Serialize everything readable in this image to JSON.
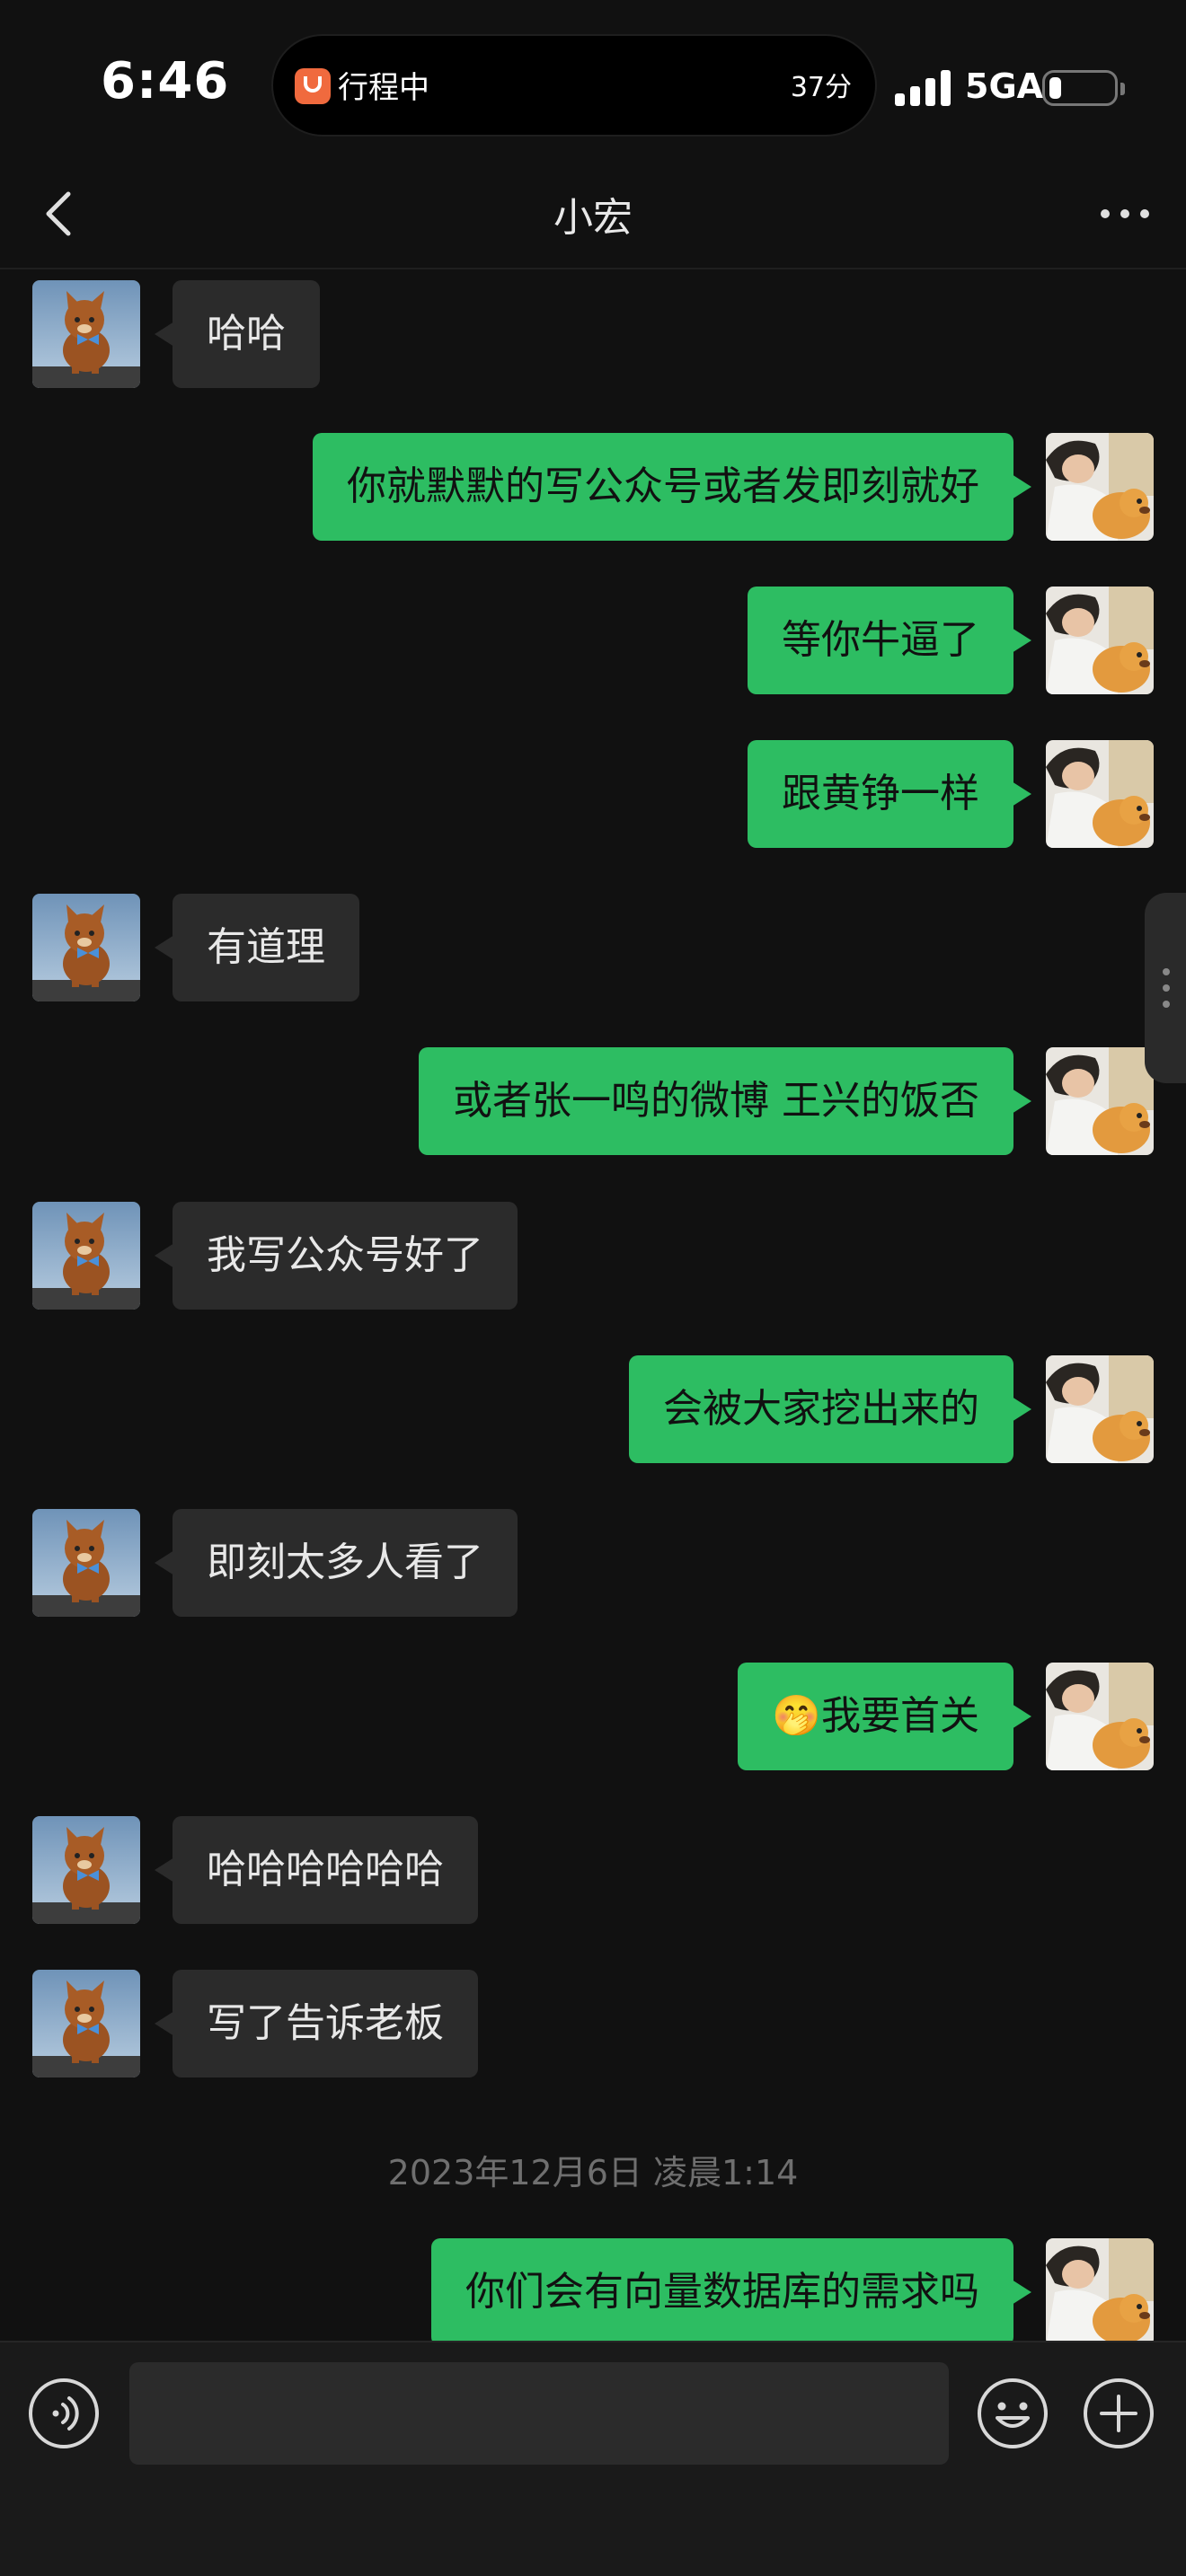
{
  "status_bar": {
    "time": "6:46",
    "trip_label": "行程中",
    "trip_minutes": "37分",
    "network": "5GA",
    "battery_level": 0.2
  },
  "header": {
    "title": "小宏"
  },
  "messages": [
    {
      "side": "in",
      "text": "哈哈"
    },
    {
      "side": "out",
      "text": "你就默默的写公众号或者发即刻就好"
    },
    {
      "side": "out",
      "text": "等你牛逼了"
    },
    {
      "side": "out",
      "text": "跟黄铮一样"
    },
    {
      "side": "in",
      "text": "有道理"
    },
    {
      "side": "out",
      "text": "或者张一鸣的微博 王兴的饭否"
    },
    {
      "side": "in",
      "text": "我写公众号好了"
    },
    {
      "side": "out",
      "text": "会被大家挖出来的"
    },
    {
      "side": "in",
      "text": "即刻太多人看了"
    },
    {
      "side": "out",
      "text": "🤭我要首关"
    },
    {
      "side": "in",
      "text": "哈哈哈哈哈哈"
    },
    {
      "side": "in",
      "text": "写了告诉老板"
    },
    {
      "side": "out",
      "text": "你们会有向量数据库的需求吗"
    }
  ],
  "timestamp": "2023年12月6日 凌晨1:14",
  "input": {
    "placeholder": ""
  },
  "colors": {
    "background": "#111111",
    "incoming_bubble": "#2b2b2b",
    "outgoing_bubble": "#2dbd62"
  }
}
